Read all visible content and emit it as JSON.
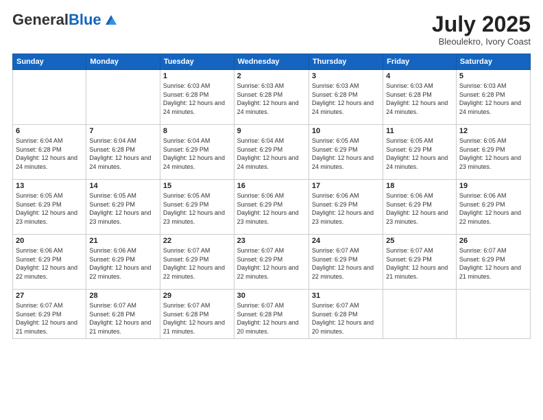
{
  "header": {
    "logo_general": "General",
    "logo_blue": "Blue",
    "month": "July 2025",
    "location": "Bleoulekro, Ivory Coast"
  },
  "days_of_week": [
    "Sunday",
    "Monday",
    "Tuesday",
    "Wednesday",
    "Thursday",
    "Friday",
    "Saturday"
  ],
  "weeks": [
    [
      {
        "day": "",
        "info": ""
      },
      {
        "day": "",
        "info": ""
      },
      {
        "day": "1",
        "info": "Sunrise: 6:03 AM\nSunset: 6:28 PM\nDaylight: 12 hours and 24 minutes."
      },
      {
        "day": "2",
        "info": "Sunrise: 6:03 AM\nSunset: 6:28 PM\nDaylight: 12 hours and 24 minutes."
      },
      {
        "day": "3",
        "info": "Sunrise: 6:03 AM\nSunset: 6:28 PM\nDaylight: 12 hours and 24 minutes."
      },
      {
        "day": "4",
        "info": "Sunrise: 6:03 AM\nSunset: 6:28 PM\nDaylight: 12 hours and 24 minutes."
      },
      {
        "day": "5",
        "info": "Sunrise: 6:03 AM\nSunset: 6:28 PM\nDaylight: 12 hours and 24 minutes."
      }
    ],
    [
      {
        "day": "6",
        "info": "Sunrise: 6:04 AM\nSunset: 6:28 PM\nDaylight: 12 hours and 24 minutes."
      },
      {
        "day": "7",
        "info": "Sunrise: 6:04 AM\nSunset: 6:28 PM\nDaylight: 12 hours and 24 minutes."
      },
      {
        "day": "8",
        "info": "Sunrise: 6:04 AM\nSunset: 6:29 PM\nDaylight: 12 hours and 24 minutes."
      },
      {
        "day": "9",
        "info": "Sunrise: 6:04 AM\nSunset: 6:29 PM\nDaylight: 12 hours and 24 minutes."
      },
      {
        "day": "10",
        "info": "Sunrise: 6:05 AM\nSunset: 6:29 PM\nDaylight: 12 hours and 24 minutes."
      },
      {
        "day": "11",
        "info": "Sunrise: 6:05 AM\nSunset: 6:29 PM\nDaylight: 12 hours and 24 minutes."
      },
      {
        "day": "12",
        "info": "Sunrise: 6:05 AM\nSunset: 6:29 PM\nDaylight: 12 hours and 23 minutes."
      }
    ],
    [
      {
        "day": "13",
        "info": "Sunrise: 6:05 AM\nSunset: 6:29 PM\nDaylight: 12 hours and 23 minutes."
      },
      {
        "day": "14",
        "info": "Sunrise: 6:05 AM\nSunset: 6:29 PM\nDaylight: 12 hours and 23 minutes."
      },
      {
        "day": "15",
        "info": "Sunrise: 6:05 AM\nSunset: 6:29 PM\nDaylight: 12 hours and 23 minutes."
      },
      {
        "day": "16",
        "info": "Sunrise: 6:06 AM\nSunset: 6:29 PM\nDaylight: 12 hours and 23 minutes."
      },
      {
        "day": "17",
        "info": "Sunrise: 6:06 AM\nSunset: 6:29 PM\nDaylight: 12 hours and 23 minutes."
      },
      {
        "day": "18",
        "info": "Sunrise: 6:06 AM\nSunset: 6:29 PM\nDaylight: 12 hours and 23 minutes."
      },
      {
        "day": "19",
        "info": "Sunrise: 6:06 AM\nSunset: 6:29 PM\nDaylight: 12 hours and 22 minutes."
      }
    ],
    [
      {
        "day": "20",
        "info": "Sunrise: 6:06 AM\nSunset: 6:29 PM\nDaylight: 12 hours and 22 minutes."
      },
      {
        "day": "21",
        "info": "Sunrise: 6:06 AM\nSunset: 6:29 PM\nDaylight: 12 hours and 22 minutes."
      },
      {
        "day": "22",
        "info": "Sunrise: 6:07 AM\nSunset: 6:29 PM\nDaylight: 12 hours and 22 minutes."
      },
      {
        "day": "23",
        "info": "Sunrise: 6:07 AM\nSunset: 6:29 PM\nDaylight: 12 hours and 22 minutes."
      },
      {
        "day": "24",
        "info": "Sunrise: 6:07 AM\nSunset: 6:29 PM\nDaylight: 12 hours and 22 minutes."
      },
      {
        "day": "25",
        "info": "Sunrise: 6:07 AM\nSunset: 6:29 PM\nDaylight: 12 hours and 21 minutes."
      },
      {
        "day": "26",
        "info": "Sunrise: 6:07 AM\nSunset: 6:29 PM\nDaylight: 12 hours and 21 minutes."
      }
    ],
    [
      {
        "day": "27",
        "info": "Sunrise: 6:07 AM\nSunset: 6:29 PM\nDaylight: 12 hours and 21 minutes."
      },
      {
        "day": "28",
        "info": "Sunrise: 6:07 AM\nSunset: 6:28 PM\nDaylight: 12 hours and 21 minutes."
      },
      {
        "day": "29",
        "info": "Sunrise: 6:07 AM\nSunset: 6:28 PM\nDaylight: 12 hours and 21 minutes."
      },
      {
        "day": "30",
        "info": "Sunrise: 6:07 AM\nSunset: 6:28 PM\nDaylight: 12 hours and 20 minutes."
      },
      {
        "day": "31",
        "info": "Sunrise: 6:07 AM\nSunset: 6:28 PM\nDaylight: 12 hours and 20 minutes."
      },
      {
        "day": "",
        "info": ""
      },
      {
        "day": "",
        "info": ""
      }
    ]
  ]
}
